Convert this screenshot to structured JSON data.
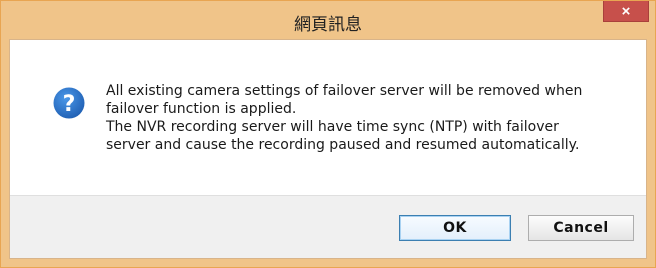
{
  "window": {
    "title": "網頁訊息",
    "close_label": "×"
  },
  "message": {
    "line1": "All existing camera settings of failover server will be removed when",
    "line2": "failover function is applied.",
    "line3": "The NVR recording server will have time sync (NTP) with failover",
    "line4": "server and cause the recording paused and resumed automatically."
  },
  "icon": {
    "name": "question-icon",
    "color": "#1f6cc4"
  },
  "buttons": {
    "ok_label": "OK",
    "cancel_label": "Cancel"
  },
  "colors": {
    "frame": "#f0c489",
    "close_button": "#c7504b",
    "footer": "#f0f0f0"
  }
}
